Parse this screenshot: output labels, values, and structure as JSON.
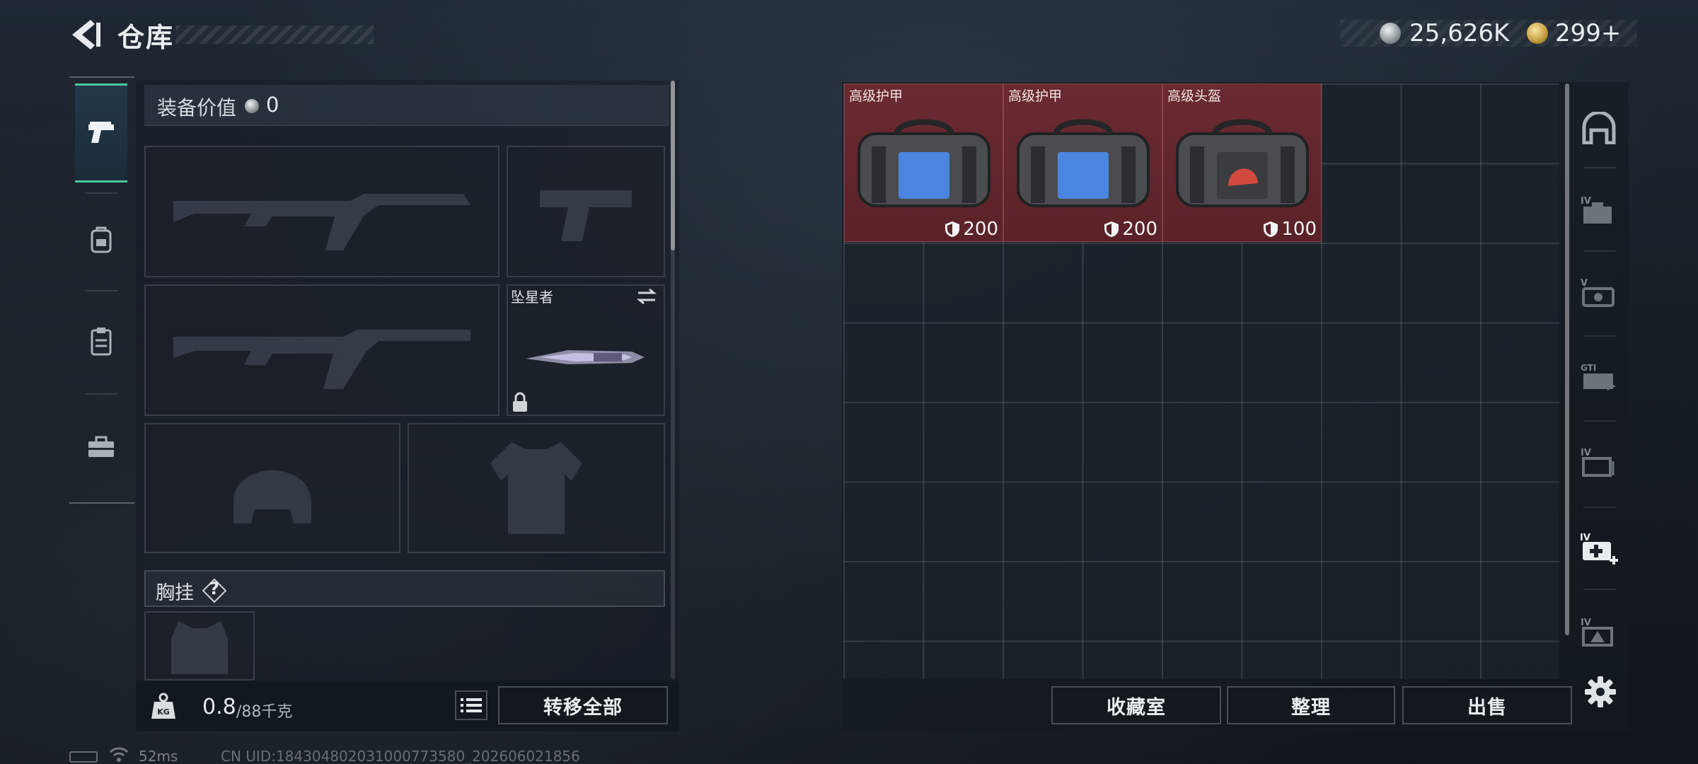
{
  "header": {
    "title": "仓库"
  },
  "currency": [
    {
      "icon": "silver-coin-icon",
      "value": "25,626K"
    },
    {
      "icon": "gold-coin-icon",
      "value": "299+"
    }
  ],
  "left_rail": [
    {
      "icon": "pistol-icon",
      "active": true
    },
    {
      "icon": "backpack-icon",
      "active": false
    },
    {
      "icon": "clipboard-icon",
      "active": false
    },
    {
      "icon": "toolbox-icon",
      "active": false
    }
  ],
  "loadout": {
    "value_label": "装备价值",
    "value": "0",
    "melee_name": "坠星者",
    "chest_label": "胸挂",
    "help": "?",
    "weight_current": "0.8",
    "weight_max": "/88千克",
    "transfer_all": "转移全部"
  },
  "stash": {
    "items": [
      {
        "name": "高级护甲",
        "stat": "200",
        "emblem_color": "#4a86e0"
      },
      {
        "name": "高级护甲",
        "stat": "200",
        "emblem_color": "#4a86e0"
      },
      {
        "name": "高级头盔",
        "stat": "100",
        "emblem_color": "#d24a3e"
      }
    ]
  },
  "right_rail": [
    "storage-dome-icon",
    "level-iv-case-icon",
    "level-v-case-icon",
    "gti-case-icon",
    "level-iv-card-icon",
    "level-iv-medkit-icon",
    "level-iv-box-icon"
  ],
  "bottom_buttons": {
    "collection": "收藏室",
    "tidy": "整理",
    "sell": "出售"
  },
  "status": {
    "ping": "52ms",
    "uid": "CN UID:184304802031000773580_202606021856"
  },
  "colors": {
    "accent": "#48c79a",
    "item_bg": "#6b2a31"
  }
}
